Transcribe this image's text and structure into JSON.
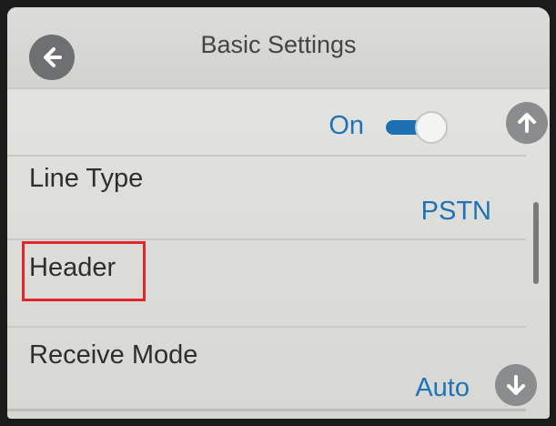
{
  "header": {
    "title": "Basic Settings",
    "back_icon": "arrow-left-icon"
  },
  "rows": [
    {
      "type": "toggle",
      "value_label": "On",
      "state": true
    },
    {
      "label": "Line Type",
      "value": "PSTN"
    },
    {
      "label": "Header",
      "value": ""
    },
    {
      "label": "Receive Mode",
      "value": "Auto"
    }
  ],
  "scroll": {
    "up_icon": "arrow-up-icon",
    "down_icon": "arrow-down-icon"
  },
  "colors": {
    "accent": "#1d72b8",
    "highlight": "#e0262a",
    "button_gray": "#6e6f70"
  }
}
